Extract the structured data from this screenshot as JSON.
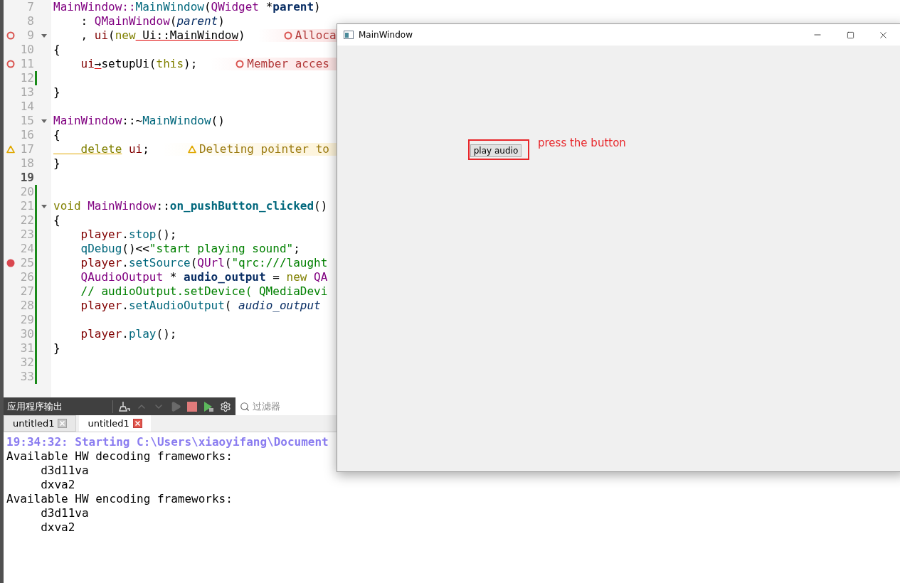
{
  "editor": {
    "lines": [
      {
        "number": "7",
        "current": false,
        "changed": false,
        "fold": false,
        "breakpoint": false,
        "tokens": [
          {
            "kind": "type",
            "text": "MainWindow"
          },
          {
            "kind": "type",
            "text": "::"
          },
          {
            "kind": "func",
            "text": "MainWindow"
          },
          {
            "kind": "plain",
            "text": "("
          },
          {
            "kind": "type",
            "text": "QWidget"
          },
          {
            "kind": "plain",
            "text": " *"
          },
          {
            "kind": "local",
            "text": "parent"
          },
          {
            "kind": "plain",
            "text": ")"
          }
        ]
      },
      {
        "number": "8",
        "current": false,
        "changed": false,
        "fold": false,
        "breakpoint": false,
        "tokens": [
          {
            "kind": "plain",
            "text": "    : "
          },
          {
            "kind": "type",
            "text": "QMainWindow"
          },
          {
            "kind": "plain",
            "text": "("
          },
          {
            "kind": "param",
            "text": "parent"
          },
          {
            "kind": "plain",
            "text": ")"
          }
        ]
      },
      {
        "number": "9",
        "current": false,
        "changed": false,
        "fold": true,
        "breakpoint": false,
        "tokens": [
          {
            "kind": "plain",
            "text": "    , "
          },
          {
            "kind": "member",
            "text": "ui"
          },
          {
            "kind": "plain",
            "text": "("
          },
          {
            "kind": "keyword",
            "text": "new"
          },
          {
            "kind": "error",
            "text": " Ui::MainWindow"
          },
          {
            "kind": "plain",
            "text": ")"
          }
        ],
        "annotation": {
          "kind": "error",
          "text": "Alloca"
        }
      },
      {
        "number": "10",
        "current": false,
        "changed": false,
        "fold": false,
        "breakpoint": false,
        "tokens": [
          {
            "kind": "plain",
            "text": "{"
          }
        ]
      },
      {
        "number": "11",
        "current": false,
        "changed": false,
        "fold": false,
        "breakpoint": false,
        "tokens": [
          {
            "kind": "member",
            "text": "    ui"
          },
          {
            "kind": "error",
            "text": "→"
          },
          {
            "kind": "plain",
            "text": "setupUi("
          },
          {
            "kind": "keyword",
            "text": "this"
          },
          {
            "kind": "plain",
            "text": ");"
          }
        ],
        "annotation": {
          "kind": "error",
          "text": "Member acces"
        }
      },
      {
        "number": "12",
        "current": false,
        "changed": true,
        "fold": false,
        "breakpoint": false
      },
      {
        "number": "13",
        "current": false,
        "changed": false,
        "fold": false,
        "breakpoint": false,
        "tokens": [
          {
            "kind": "plain",
            "text": "}"
          }
        ]
      },
      {
        "number": "14",
        "current": false,
        "changed": false,
        "fold": false,
        "breakpoint": false
      },
      {
        "number": "15",
        "current": false,
        "changed": false,
        "fold": true,
        "breakpoint": false,
        "tokens": [
          {
            "kind": "type",
            "text": "MainWindow"
          },
          {
            "kind": "plain",
            "text": "::~"
          },
          {
            "kind": "func",
            "text": "MainWindow"
          },
          {
            "kind": "plain",
            "text": "()"
          }
        ]
      },
      {
        "number": "16",
        "current": false,
        "changed": false,
        "fold": false,
        "breakpoint": false,
        "tokens": [
          {
            "kind": "plain",
            "text": "{"
          }
        ]
      },
      {
        "number": "17",
        "current": false,
        "changed": false,
        "fold": false,
        "breakpoint": false,
        "tokens": [
          {
            "kind": "warning",
            "text": "    delete"
          },
          {
            "kind": "member",
            "text": " ui"
          },
          {
            "kind": "plain",
            "text": ";"
          }
        ],
        "annotation": {
          "kind": "warning",
          "text": "Deleting pointer to"
        }
      },
      {
        "number": "18",
        "current": false,
        "changed": false,
        "fold": false,
        "breakpoint": false,
        "tokens": [
          {
            "kind": "plain",
            "text": "}"
          }
        ]
      },
      {
        "number": "19",
        "current": true,
        "changed": false,
        "fold": false,
        "breakpoint": false
      },
      {
        "number": "20",
        "current": false,
        "changed": true,
        "fold": false,
        "breakpoint": false
      },
      {
        "number": "21",
        "current": false,
        "changed": true,
        "fold": true,
        "breakpoint": false,
        "tokens": [
          {
            "kind": "keyword",
            "text": "void"
          },
          {
            "kind": "type",
            "text": " MainWindow"
          },
          {
            "kind": "plain",
            "text": "::"
          },
          {
            "kind": "funcdef",
            "text": "on_pushButton_clicked"
          },
          {
            "kind": "plain",
            "text": "()"
          }
        ]
      },
      {
        "number": "22",
        "current": false,
        "changed": true,
        "fold": false,
        "breakpoint": false,
        "tokens": [
          {
            "kind": "plain",
            "text": "{"
          }
        ]
      },
      {
        "number": "23",
        "current": false,
        "changed": true,
        "fold": false,
        "breakpoint": false,
        "tokens": [
          {
            "kind": "member",
            "text": "    player"
          },
          {
            "kind": "plain",
            "text": "."
          },
          {
            "kind": "func",
            "text": "stop"
          },
          {
            "kind": "plain",
            "text": "();"
          }
        ]
      },
      {
        "number": "24",
        "current": false,
        "changed": true,
        "fold": false,
        "breakpoint": false,
        "tokens": [
          {
            "kind": "func",
            "text": "    qDebug"
          },
          {
            "kind": "plain",
            "text": "()<<"
          },
          {
            "kind": "string",
            "text": "\"start playing sound\""
          },
          {
            "kind": "plain",
            "text": ";"
          }
        ]
      },
      {
        "number": "25",
        "current": false,
        "changed": true,
        "fold": false,
        "breakpoint": true,
        "tokens": [
          {
            "kind": "member",
            "text": "    player"
          },
          {
            "kind": "plain",
            "text": "."
          },
          {
            "kind": "func",
            "text": "setSource"
          },
          {
            "kind": "plain",
            "text": "("
          },
          {
            "kind": "type",
            "text": "QUrl"
          },
          {
            "kind": "plain",
            "text": "("
          },
          {
            "kind": "string",
            "text": "\"qrc:///laught"
          }
        ]
      },
      {
        "number": "26",
        "current": false,
        "changed": true,
        "fold": false,
        "breakpoint": false,
        "tokens": [
          {
            "kind": "type",
            "text": "    QAudioOutput"
          },
          {
            "kind": "plain",
            "text": " * "
          },
          {
            "kind": "local",
            "text": "audio_output"
          },
          {
            "kind": "plain",
            "text": " = "
          },
          {
            "kind": "keyword",
            "text": "new"
          },
          {
            "kind": "type",
            "text": " QA"
          }
        ]
      },
      {
        "number": "27",
        "current": false,
        "changed": true,
        "fold": false,
        "breakpoint": false,
        "tokens": [
          {
            "kind": "comment",
            "text": "    // audioOutput.setDevice( QMediaDevi"
          }
        ]
      },
      {
        "number": "28",
        "current": false,
        "changed": true,
        "fold": false,
        "breakpoint": false,
        "tokens": [
          {
            "kind": "member",
            "text": "    player"
          },
          {
            "kind": "plain",
            "text": "."
          },
          {
            "kind": "func",
            "text": "setAudioOutput"
          },
          {
            "kind": "plain",
            "text": "( "
          },
          {
            "kind": "param",
            "text": "audio_output"
          }
        ]
      },
      {
        "number": "29",
        "current": false,
        "changed": true,
        "fold": false,
        "breakpoint": false
      },
      {
        "number": "30",
        "current": false,
        "changed": true,
        "fold": false,
        "breakpoint": false,
        "tokens": [
          {
            "kind": "member",
            "text": "    player"
          },
          {
            "kind": "plain",
            "text": "."
          },
          {
            "kind": "func",
            "text": "play"
          },
          {
            "kind": "plain",
            "text": "();"
          }
        ]
      },
      {
        "number": "31",
        "current": false,
        "changed": true,
        "fold": false,
        "breakpoint": false,
        "tokens": [
          {
            "kind": "plain",
            "text": "}"
          }
        ]
      },
      {
        "number": "32",
        "current": false,
        "changed": true,
        "fold": false,
        "breakpoint": false
      },
      {
        "number": "33",
        "current": false,
        "changed": true,
        "fold": false,
        "breakpoint": false
      }
    ]
  },
  "output_pane": {
    "title": "应用程序输出",
    "toolbar": [
      {
        "kind": "clear",
        "disabled": false
      },
      {
        "kind": "up",
        "disabled": true
      },
      {
        "kind": "down",
        "disabled": true
      },
      {
        "kind": "run",
        "disabled": true
      },
      {
        "kind": "stop",
        "disabled": false
      },
      {
        "kind": "debug",
        "disabled": false
      },
      {
        "kind": "settings",
        "disabled": false
      }
    ],
    "filter": {
      "placeholder": "过滤器"
    },
    "tabs": [
      {
        "label": "untitled1",
        "selected": false
      },
      {
        "label": "untitled1",
        "selected": true
      }
    ],
    "lines": [
      {
        "kind": "status",
        "text": "19:34:32: Starting C:\\Users\\xiaoyifang\\Document"
      },
      {
        "kind": "plain",
        "text": "Available HW decoding frameworks:"
      },
      {
        "kind": "plain",
        "text": "     d3d11va"
      },
      {
        "kind": "plain",
        "text": "     dxva2"
      },
      {
        "kind": "plain",
        "text": "Available HW encoding frameworks:"
      },
      {
        "kind": "plain",
        "text": "     d3d11va"
      },
      {
        "kind": "plain",
        "text": "     dxva2"
      }
    ]
  },
  "app_window": {
    "title": "MainWindow",
    "button": "play audio",
    "note": "press the button"
  }
}
